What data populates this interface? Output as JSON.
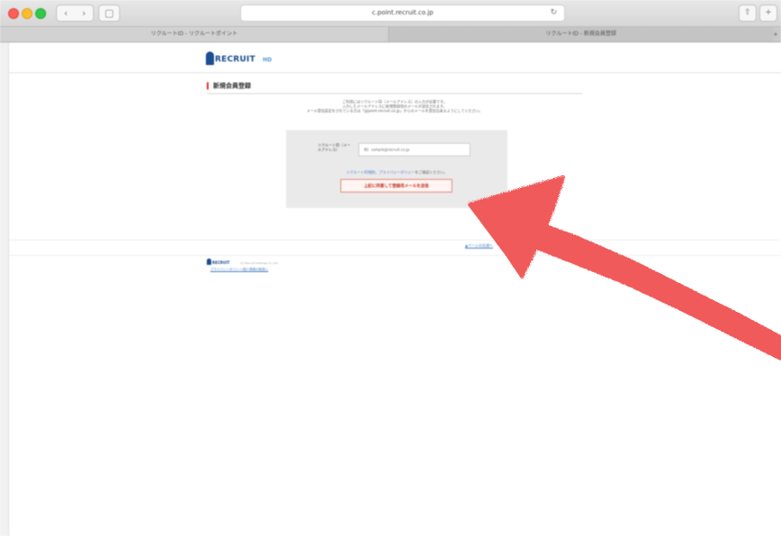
{
  "browser": {
    "url": "c.point.recruit.co.jp",
    "tabs": [
      {
        "label": "リクルートID - リクルートポイント"
      },
      {
        "label": "リクルートID - 新規会員登録"
      }
    ],
    "icons": {
      "back": "chevron-left-icon",
      "forward": "chevron-right-icon",
      "sidebar": "sidebar-icon",
      "reload": "reload-icon",
      "share": "share-icon",
      "new_tab": "plus-icon"
    }
  },
  "page": {
    "logo_text": "RECRUIT",
    "logo_suffix": "HD",
    "heading": "新規会員登録",
    "intro_lines": [
      "ご利用にはリクルートID（メールアドレス）の入力が必要です。",
      "入力したメールアドレスに新規登録用のメールが送信されます。",
      "メール受信設定をされている方は「@point.recruit.co.jp」からのメールを受信出来るようにしてください。"
    ],
    "form": {
      "label": "リクルートID（メールアドレス）",
      "email_placeholder": "例）sample@recruit.co.jp",
      "terms_prefix": "",
      "terms_link1": "リクルートID規約",
      "terms_mid": "、",
      "terms_link2": "プライバシーポリシー",
      "terms_suffix": "をご確認ください。",
      "submit_label": "上記に同意して登録用メールを送信"
    },
    "page_top_link": "▲ページの先頭へ",
    "footer": {
      "logo_text": "RECRUIT",
      "copyright": "(C) Recruit Holdings Co.,Ltd.",
      "privacy_link": "プライバシーポリシー/個人情報の取扱い"
    }
  },
  "annotation": {
    "color": "#f05a5a",
    "shape": "hand-drawn-arrow"
  }
}
